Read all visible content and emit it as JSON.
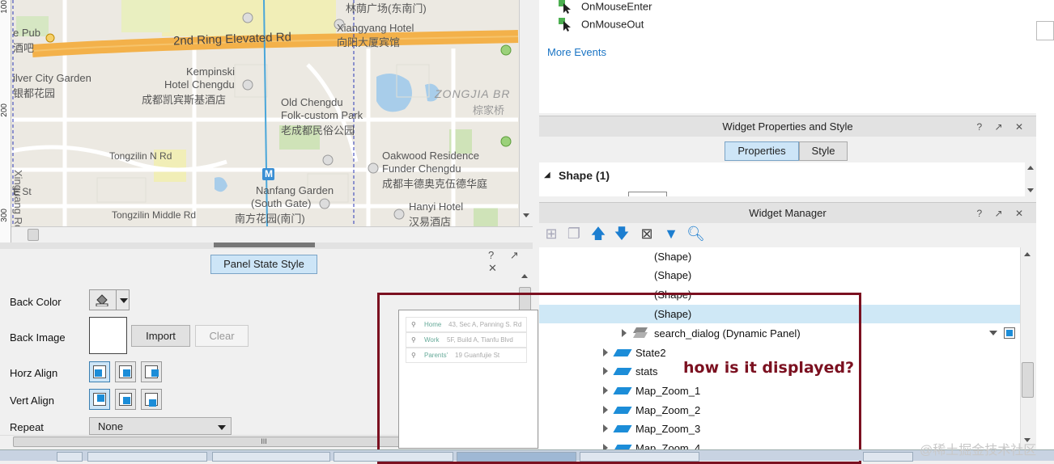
{
  "map": {
    "labels": {
      "linyin": "林荫广场(东南门)",
      "pub1": "e Pub",
      "pub2": "酒吧",
      "ring_road": "2nd Ring Elevated Rd",
      "xiangyang1": "Xiangyang Hotel",
      "xiangyang2": "向阳大厦宾馆",
      "kempinski1": "Kempinski",
      "kempinski2": "Hotel Chengdu",
      "kempinski3": "成都凯宾斯基酒店",
      "silver1": "ilver City Garden",
      "silver2": "银都花园",
      "oldchengdu1": "Old Chengdu",
      "oldchengdu2": "Folk-custom Park",
      "oldchengdu3": "老成都民俗公园",
      "zongjia1": "ZONGJIA BR",
      "zongjia2": "棕家桥",
      "xinguang": "Xinguang Rd",
      "tongzilin_n": "Tongzilin N Rd",
      "oakwood1": "Oakwood Residence",
      "oakwood2": "Funder Chengdu",
      "oakwood3": "成都丰德奥克伍德华庭",
      "est": "E St",
      "nanfang1": "Nanfang Garden",
      "nanfang2": "(South Gate)",
      "nanfang3": "南方花园(南门)",
      "hanyi1": "Hanyi Hotel",
      "hanyi2": "汉易酒店",
      "tongzilin_m": "Tongzilin Middle Rd",
      "metro": "M"
    },
    "ruler": [
      "100",
      "200",
      "300"
    ]
  },
  "panel_state_style": {
    "title": "Panel State Style",
    "controls": "? ↗ ✕",
    "back_color_label": "Back Color",
    "back_image_label": "Back Image",
    "import_label": "Import",
    "clear_label": "Clear",
    "horz_align_label": "Horz Align",
    "vert_align_label": "Vert Align",
    "repeat_label": "Repeat",
    "repeat_value": "None",
    "hscroll_grip": "III"
  },
  "preview": {
    "rows": [
      {
        "name": "Home",
        "addr": "43, Sec A, Panning S. Rd"
      },
      {
        "name": "Work",
        "addr": "5F, Build A, Tianfu Blvd"
      },
      {
        "name": "Parents'",
        "addr": "19 Guanfujie St"
      }
    ]
  },
  "annotation": "how is it displayed?",
  "events": {
    "items": [
      "OnMouseEnter",
      "OnMouseOut"
    ],
    "more": "More Events"
  },
  "widget_props": {
    "title": "Widget Properties and Style",
    "controls": "? ↗ ✕",
    "tab_properties": "Properties",
    "tab_style": "Style",
    "section": "Shape (1)"
  },
  "widget_manager": {
    "title": "Widget Manager",
    "controls": "? ↗ ✕",
    "rows": [
      {
        "label": "(Shape)",
        "indent": 142,
        "arrow": false,
        "icon": false,
        "selected": false
      },
      {
        "label": "(Shape)",
        "indent": 142,
        "arrow": false,
        "icon": false,
        "selected": false
      },
      {
        "label": "(Shape)",
        "indent": 142,
        "arrow": false,
        "icon": false,
        "selected": false
      },
      {
        "label": "(Shape)",
        "indent": 142,
        "arrow": false,
        "icon": false,
        "selected": true
      },
      {
        "label": "search_dialog (Dynamic Panel)",
        "indent": 142,
        "arrow": true,
        "icon": true,
        "selected": false
      },
      {
        "label": "State2",
        "indent": 119,
        "arrow": true,
        "icon": true,
        "selected": false
      },
      {
        "label": "stats",
        "indent": 119,
        "arrow": true,
        "icon": true,
        "selected": false
      },
      {
        "label": "Map_Zoom_1",
        "indent": 119,
        "arrow": true,
        "icon": true,
        "selected": false
      },
      {
        "label": "Map_Zoom_2",
        "indent": 119,
        "arrow": true,
        "icon": true,
        "selected": false
      },
      {
        "label": "Map_Zoom_3",
        "indent": 119,
        "arrow": true,
        "icon": true,
        "selected": false
      },
      {
        "label": "Map_Zoom_4",
        "indent": 119,
        "arrow": true,
        "icon": true,
        "selected": false
      }
    ]
  },
  "watermark": "@稀土掘金技术社区",
  "colors": {
    "accent_blue": "#1c8dd8",
    "annotation_red": "#7b1020",
    "selected_row": "#cfe8f6",
    "ring_road": "#f3b14a",
    "park_green": "#cfe3b8"
  }
}
